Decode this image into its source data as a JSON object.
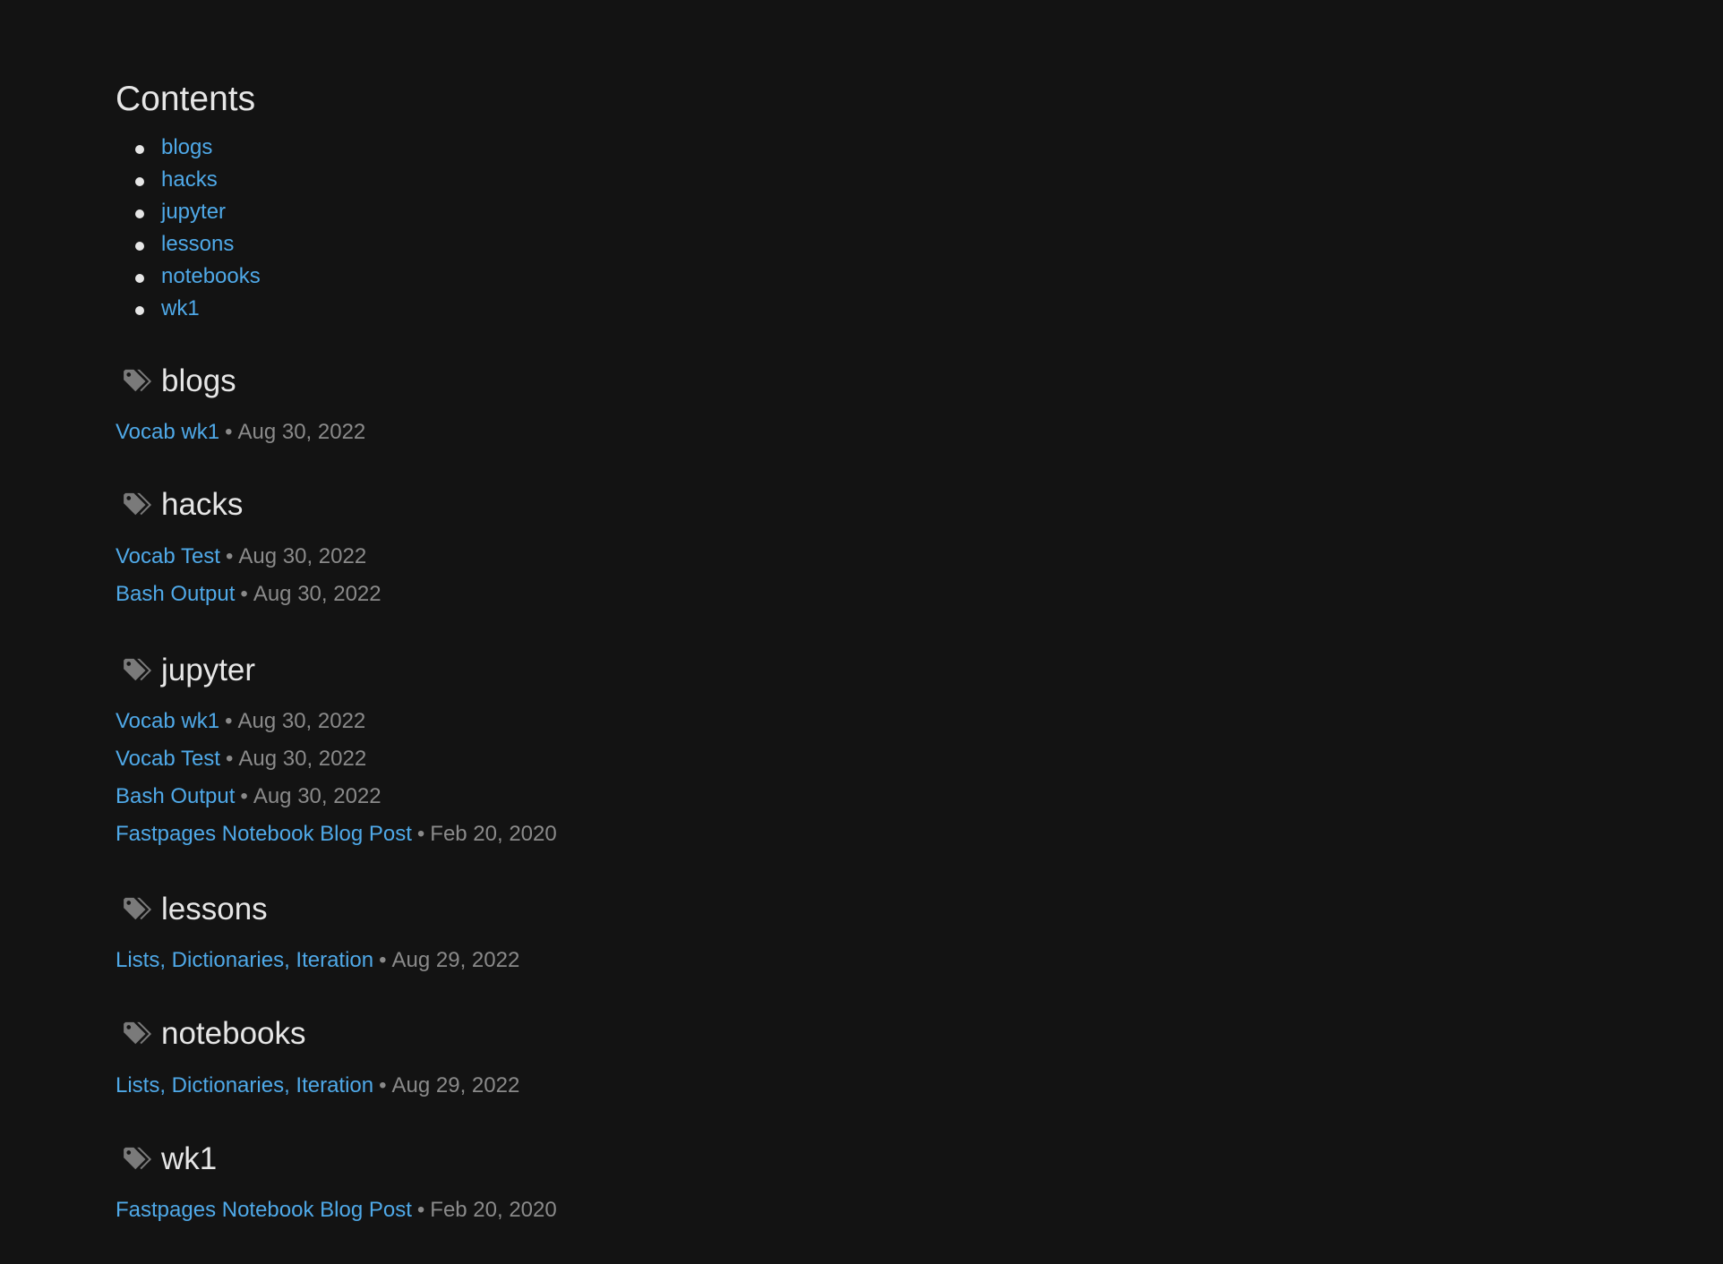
{
  "page": {
    "title": "Contents",
    "toc": [
      "blogs",
      "hacks",
      "jupyter",
      "lessons",
      "notebooks",
      "wk1"
    ]
  },
  "sections": [
    {
      "name": "blogs",
      "posts": [
        {
          "title": "Vocab wk1",
          "date": "Aug 30, 2022"
        }
      ]
    },
    {
      "name": "hacks",
      "posts": [
        {
          "title": "Vocab Test",
          "date": "Aug 30, 2022"
        },
        {
          "title": "Bash Output",
          "date": "Aug 30, 2022"
        }
      ]
    },
    {
      "name": "jupyter",
      "posts": [
        {
          "title": "Vocab wk1",
          "date": "Aug 30, 2022"
        },
        {
          "title": "Vocab Test",
          "date": "Aug 30, 2022"
        },
        {
          "title": "Bash Output",
          "date": "Aug 30, 2022"
        },
        {
          "title": "Fastpages Notebook Blog Post",
          "date": "Feb 20, 2020"
        }
      ]
    },
    {
      "name": "lessons",
      "posts": [
        {
          "title": "Lists, Dictionaries, Iteration",
          "date": "Aug 29, 2022"
        }
      ]
    },
    {
      "name": "notebooks",
      "posts": [
        {
          "title": "Lists, Dictionaries, Iteration",
          "date": "Aug 29, 2022"
        }
      ]
    },
    {
      "name": "wk1",
      "posts": [
        {
          "title": "Fastpages Notebook Blog Post",
          "date": "Feb 20, 2020"
        }
      ]
    }
  ],
  "separator": "•",
  "icons": {
    "section_icon": "tags-icon"
  },
  "colors": {
    "background": "#131313",
    "link": "#4fa9e8",
    "text": "#e6e6e6",
    "muted": "#8a8a8a",
    "icon": "#7a7a7a"
  }
}
